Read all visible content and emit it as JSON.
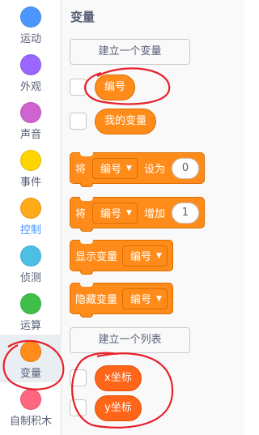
{
  "categories": [
    {
      "label": "运动",
      "color": "#4c97ff"
    },
    {
      "label": "外观",
      "color": "#9966ff"
    },
    {
      "label": "声音",
      "color": "#cf63cf"
    },
    {
      "label": "事件",
      "color": "#ffd500"
    },
    {
      "label": "控制",
      "color": "#ffab19"
    },
    {
      "label": "侦测",
      "color": "#4cbfe6"
    },
    {
      "label": "运算",
      "color": "#40bf4a"
    },
    {
      "label": "变量",
      "color": "#ff8c1a"
    },
    {
      "label": "自制积木",
      "color": "#ff6680"
    }
  ],
  "palette": {
    "heading": "变量",
    "make_variable_button": "建立一个变量",
    "variables": [
      "编号",
      "我的变量"
    ],
    "set_block": {
      "prefix": "将",
      "variable": "编号",
      "middle": "设为",
      "value": "0"
    },
    "change_block": {
      "prefix": "将",
      "variable": "编号",
      "middle": "增加",
      "value": "1"
    },
    "show_block": {
      "label": "显示变量",
      "variable": "编号"
    },
    "hide_block": {
      "label": "隐藏变量",
      "variable": "编号"
    },
    "make_list_button": "建立一个列表",
    "lists": [
      "x坐标",
      "y坐标"
    ]
  },
  "colors": {
    "variables_orange": "#ff8c1a",
    "list_orange": "#ff661a",
    "annotation_red": "#e8202a"
  }
}
